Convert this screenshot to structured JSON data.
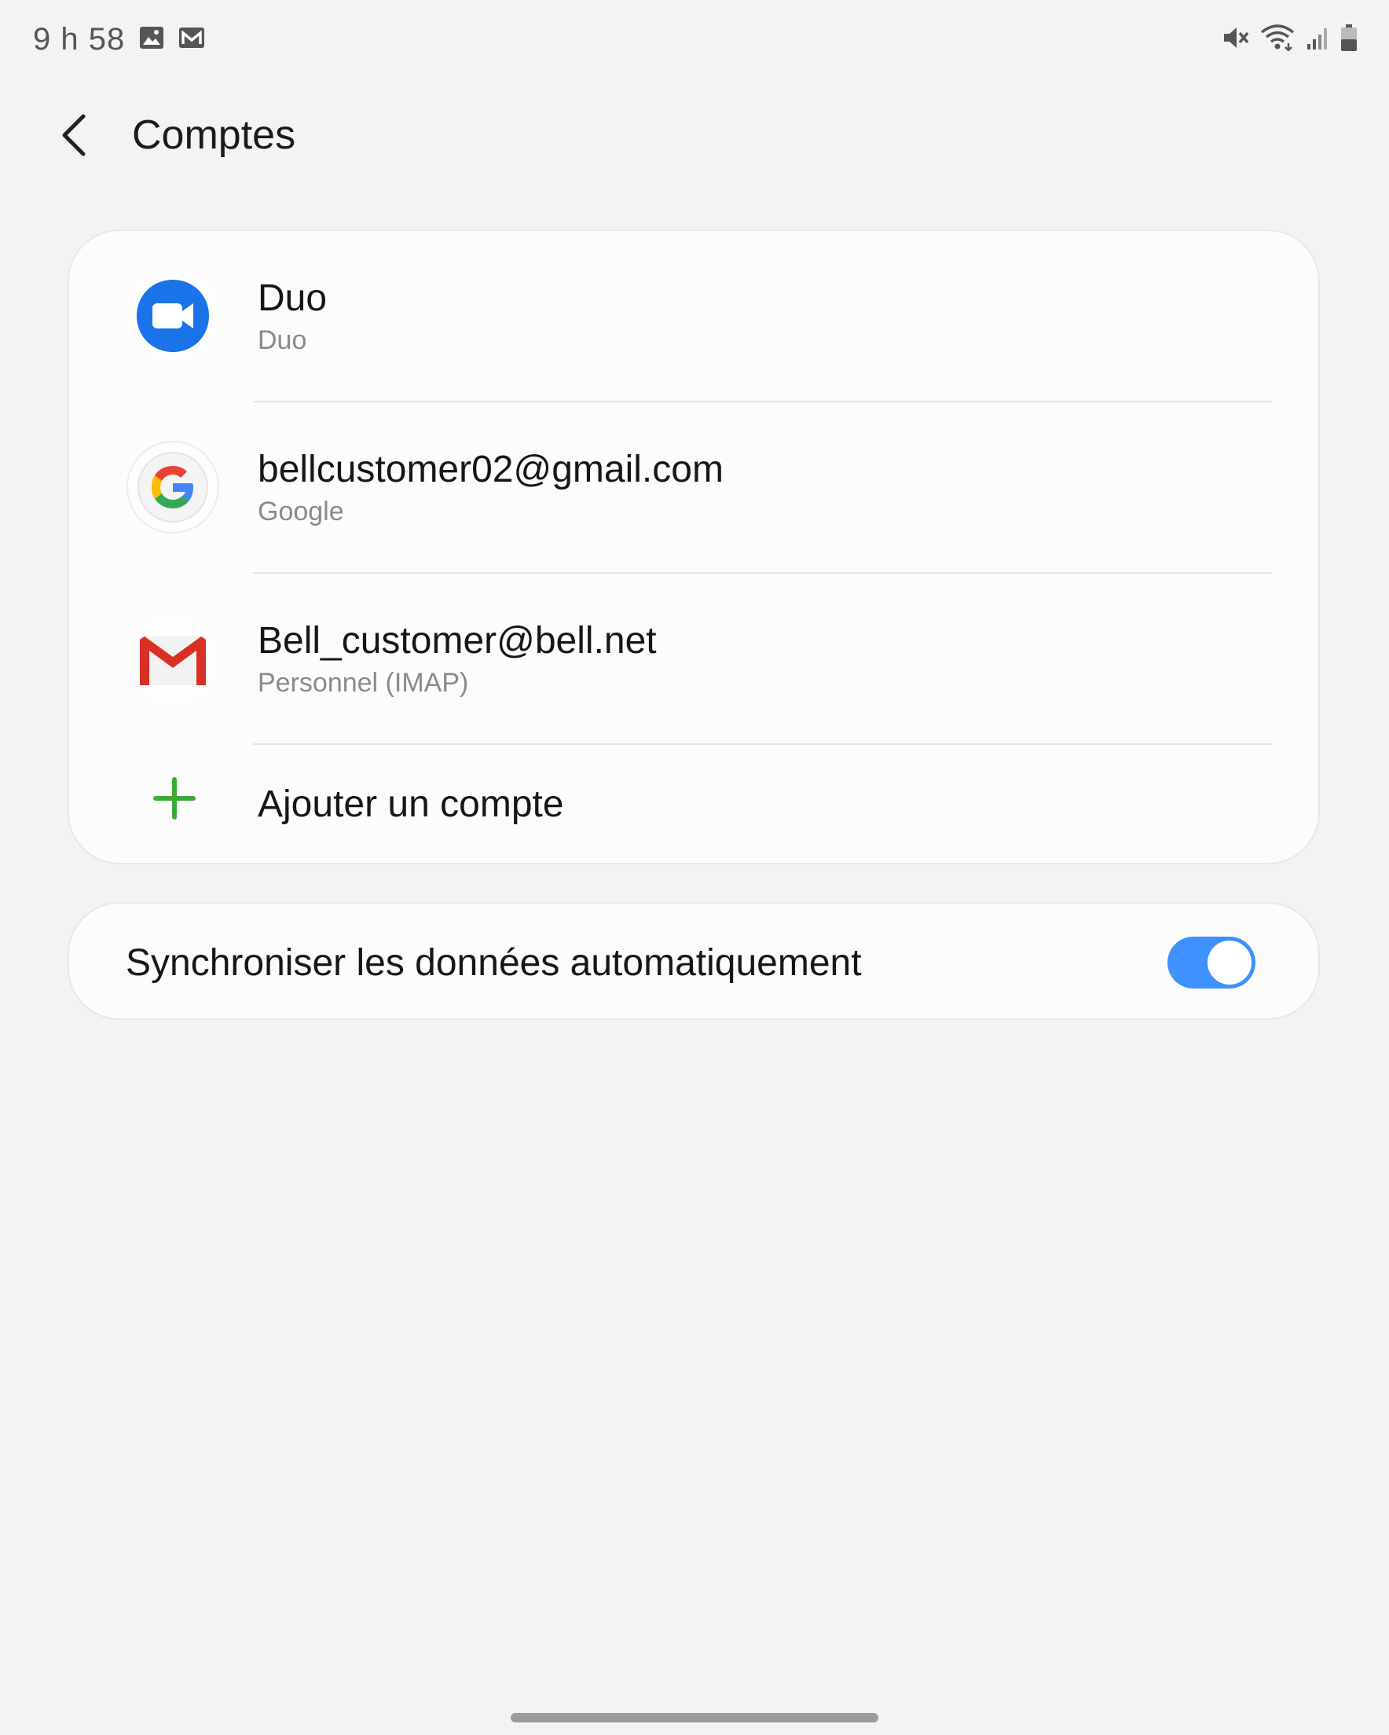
{
  "status_bar": {
    "time": "9 h 58",
    "icons_left": [
      "image-icon",
      "gmail-notification-icon"
    ],
    "icons_right": [
      "mute-icon",
      "wifi-icon",
      "signal-icon",
      "battery-icon"
    ]
  },
  "header": {
    "title": "Comptes",
    "back_icon": "chevron-left-icon"
  },
  "accounts": [
    {
      "name": "Duo",
      "type": "Duo",
      "icon": "duo-icon"
    },
    {
      "name": "bellcustomer02@gmail.com",
      "type": "Google",
      "icon": "google-icon"
    },
    {
      "name": "Bell_customer@bell.net",
      "type": "Personnel (IMAP)",
      "icon": "gmail-icon"
    }
  ],
  "add_account": {
    "label": "Ajouter un compte",
    "icon": "plus-icon"
  },
  "sync": {
    "label": "Synchroniser les données automatiquement",
    "enabled": true
  },
  "colors": {
    "background": "#f3f3f3",
    "card": "#fcfcfc",
    "toggle_on": "#3e91ff",
    "add_green": "#3daa35",
    "duo_blue": "#1a73e8",
    "gmail_red": "#d93025"
  }
}
